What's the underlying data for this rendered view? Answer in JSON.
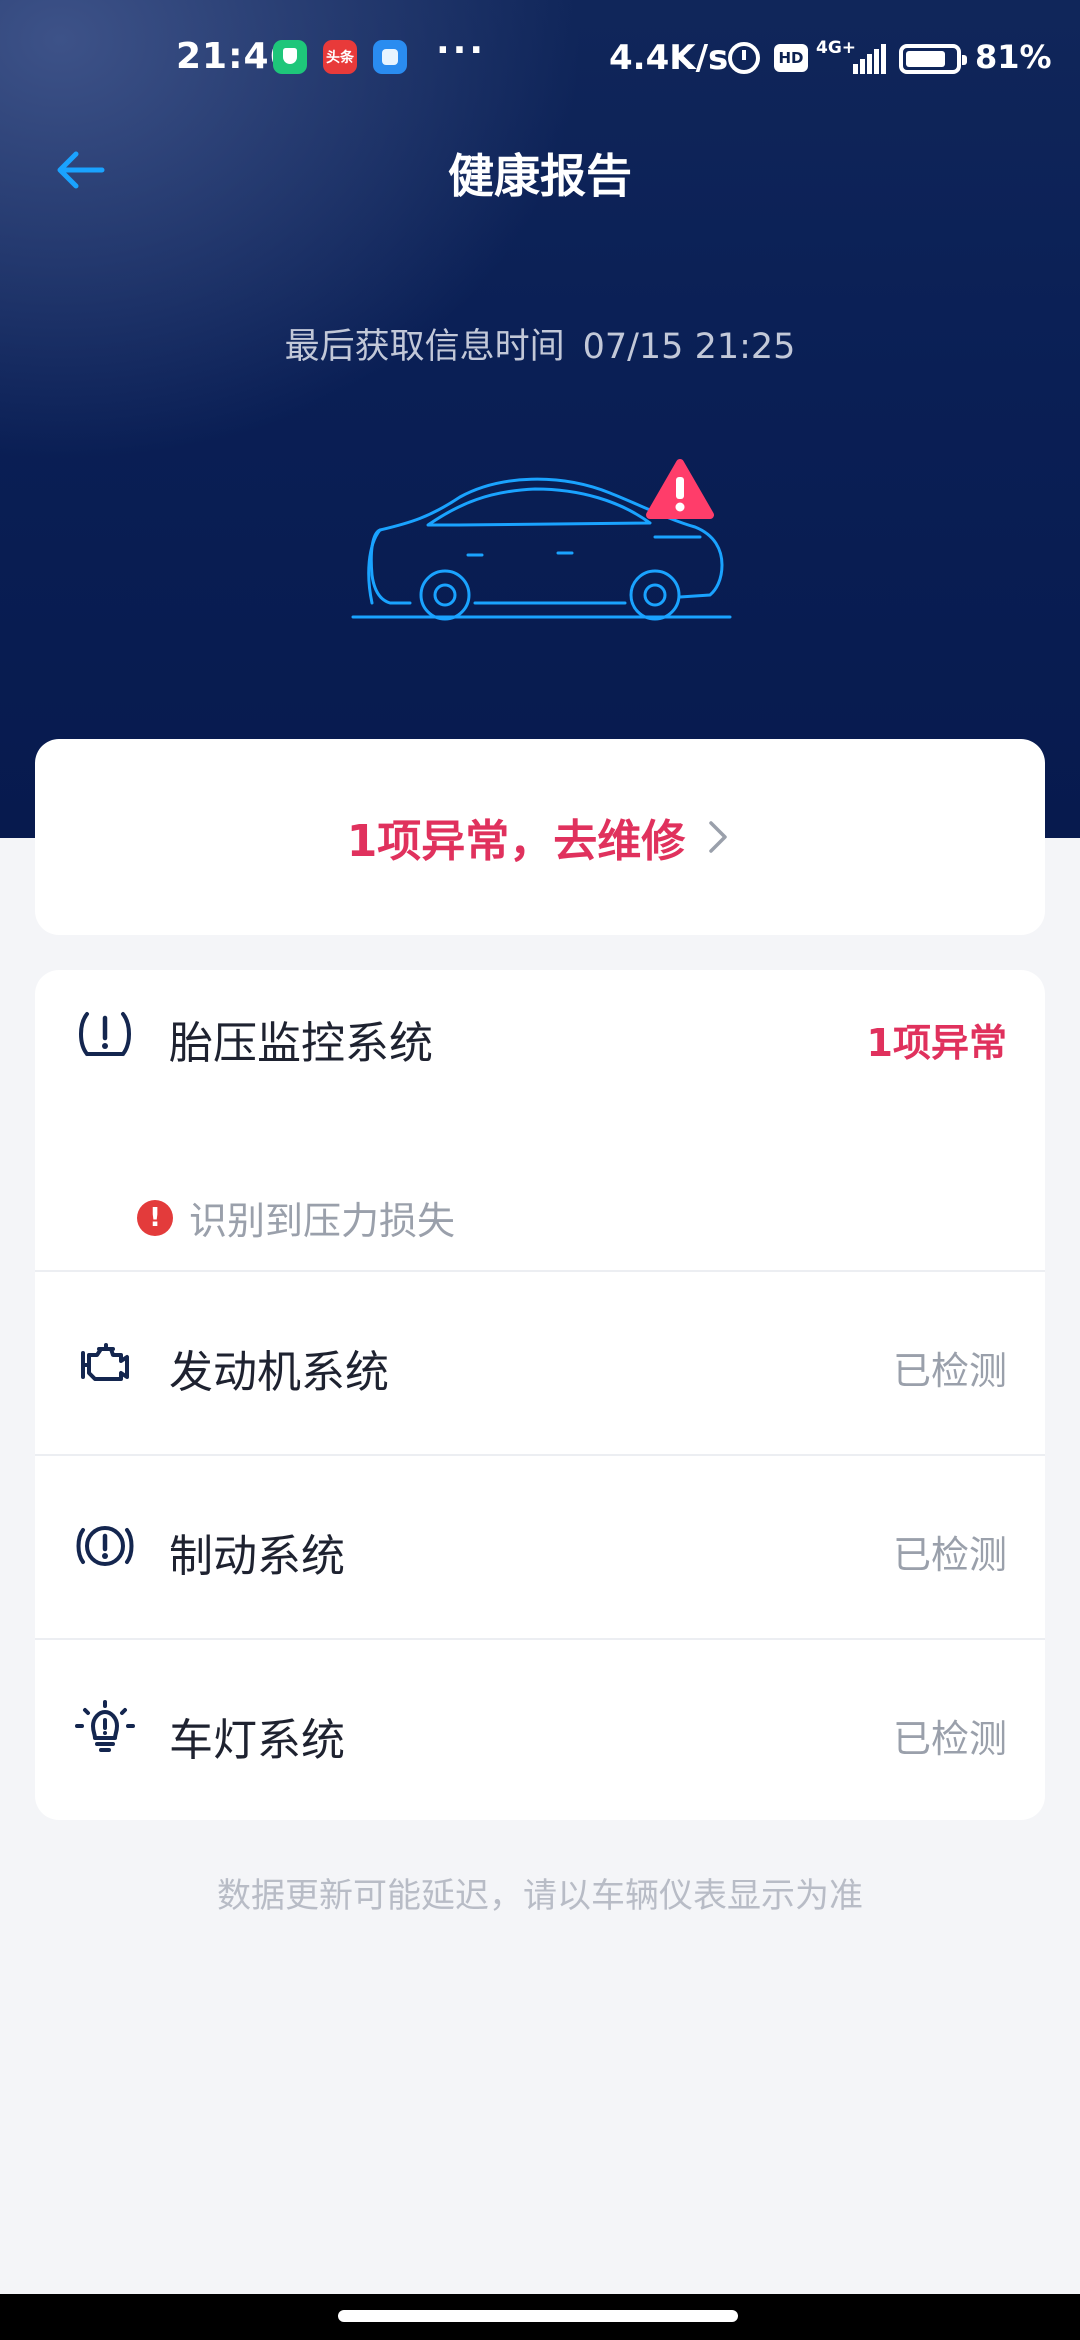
{
  "status_bar": {
    "time": "21:46",
    "notification_badge": "头条",
    "more": "···",
    "net_speed": "4.4K/s",
    "hd": "HD",
    "network": "4G+",
    "battery_percent": "81%",
    "battery_level": 0.81,
    "icons": [
      "shield-app-icon",
      "toutiao-app-icon",
      "blue-app-icon",
      "alarm-icon",
      "hd-icon",
      "signal-icon",
      "battery-icon"
    ]
  },
  "nav": {
    "title": "健康报告",
    "back_icon": "back-arrow-icon"
  },
  "info": {
    "last_fetch_label": "最后获取信息时间",
    "last_fetch_time": "07/15 21:25"
  },
  "repair": {
    "text": "1项异常，去维修",
    "icon": "chevron-right-icon"
  },
  "systems": [
    {
      "name": "胎压监控系统",
      "status": "1项异常",
      "icon": "tire-pressure-icon",
      "alert": "识别到压力损失",
      "alert_icon": "alert-circle-icon"
    },
    {
      "name": "发动机系统",
      "status": "已检测",
      "icon": "engine-icon"
    },
    {
      "name": "制动系统",
      "status": "已检测",
      "icon": "brake-icon"
    },
    {
      "name": "车灯系统",
      "status": "已检测",
      "icon": "light-bulb-icon"
    }
  ],
  "footnote": "数据更新可能延迟，请以车辆仪表显示为准",
  "colors": {
    "header_bg": "#0a1f55",
    "accent_blue": "#1aa3ff",
    "warning_red": "#e0315d",
    "alert_red": "#e33b3b",
    "muted_text": "#9aa0ab"
  }
}
